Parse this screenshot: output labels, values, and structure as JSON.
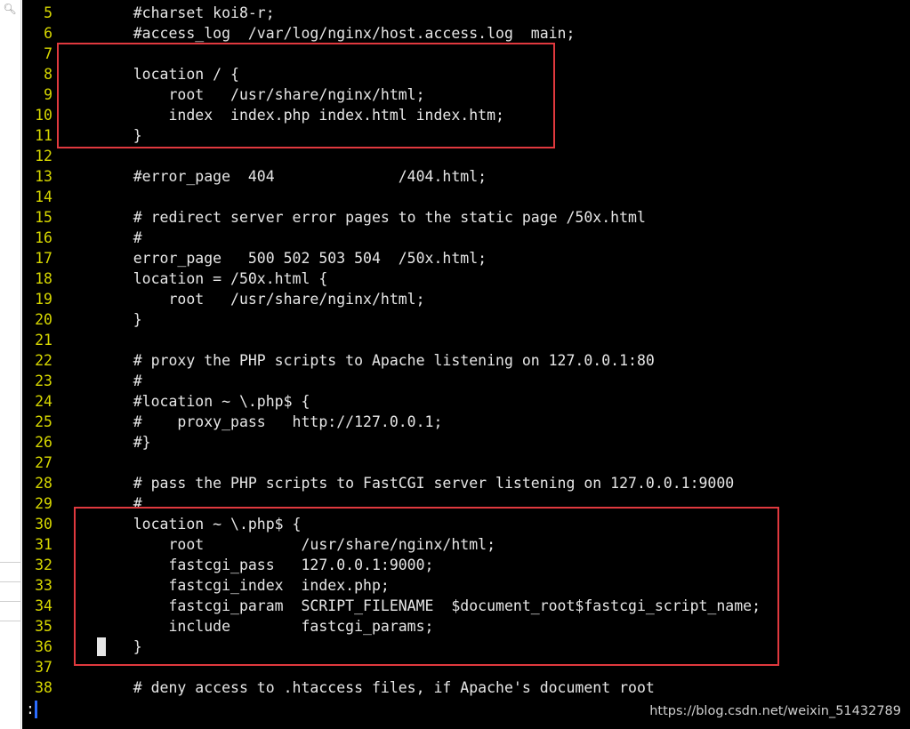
{
  "sidebar": {
    "search_icon": "search-icon"
  },
  "editor": {
    "lines": [
      {
        "n": "5",
        "t": "    #charset koi8-r;"
      },
      {
        "n": "6",
        "t": "    #access_log  /var/log/nginx/host.access.log  main;"
      },
      {
        "n": "7",
        "t": ""
      },
      {
        "n": "8",
        "t": "    location / {"
      },
      {
        "n": "9",
        "t": "        root   /usr/share/nginx/html;"
      },
      {
        "n": "10",
        "t": "        index  index.php index.html index.htm;"
      },
      {
        "n": "11",
        "t": "    }"
      },
      {
        "n": "12",
        "t": ""
      },
      {
        "n": "13",
        "t": "    #error_page  404              /404.html;"
      },
      {
        "n": "14",
        "t": ""
      },
      {
        "n": "15",
        "t": "    # redirect server error pages to the static page /50x.html"
      },
      {
        "n": "16",
        "t": "    #"
      },
      {
        "n": "17",
        "t": "    error_page   500 502 503 504  /50x.html;"
      },
      {
        "n": "18",
        "t": "    location = /50x.html {"
      },
      {
        "n": "19",
        "t": "        root   /usr/share/nginx/html;"
      },
      {
        "n": "20",
        "t": "    }"
      },
      {
        "n": "21",
        "t": ""
      },
      {
        "n": "22",
        "t": "    # proxy the PHP scripts to Apache listening on 127.0.0.1:80"
      },
      {
        "n": "23",
        "t": "    #"
      },
      {
        "n": "24",
        "t": "    #location ~ \\.php$ {"
      },
      {
        "n": "25",
        "t": "    #    proxy_pass   http://127.0.0.1;"
      },
      {
        "n": "26",
        "t": "    #}"
      },
      {
        "n": "27",
        "t": ""
      },
      {
        "n": "28",
        "t": "    # pass the PHP scripts to FastCGI server listening on 127.0.0.1:9000"
      },
      {
        "n": "29",
        "t": "    #"
      },
      {
        "n": "30",
        "t": "    location ~ \\.php$ {"
      },
      {
        "n": "31",
        "t": "        root           /usr/share/nginx/html;"
      },
      {
        "n": "32",
        "t": "        fastcgi_pass   127.0.0.1:9000;"
      },
      {
        "n": "33",
        "t": "        fastcgi_index  index.php;"
      },
      {
        "n": "34",
        "t": "        fastcgi_param  SCRIPT_FILENAME  $document_root$fastcgi_script_name;"
      },
      {
        "n": "35",
        "t": "        include        fastcgi_params;"
      },
      {
        "n": "36",
        "t": "    }"
      },
      {
        "n": "37",
        "t": ""
      },
      {
        "n": "38",
        "t": "    # deny access to .htaccess files, if Apache's document root"
      }
    ],
    "status_text": ":",
    "colors": {
      "background": "#000000",
      "line_number": "#d7d700",
      "text": "#e6e6e6",
      "highlight": "#e0393e"
    }
  },
  "watermark": "https://blog.csdn.net/weixin_51432789"
}
